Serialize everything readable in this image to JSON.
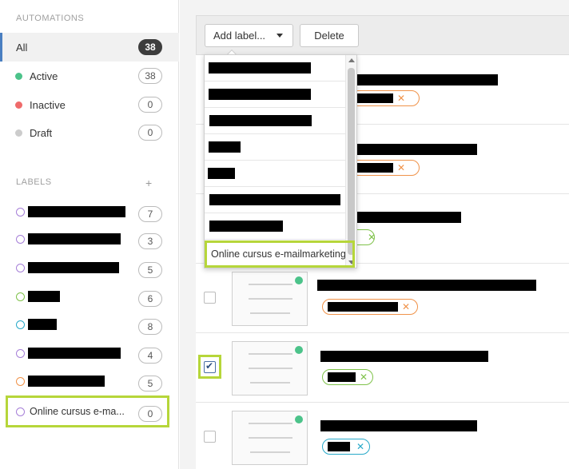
{
  "sidebar": {
    "automations_title": "AUTOMATIONS",
    "items": [
      {
        "label": "All",
        "count": "38"
      },
      {
        "label": "Active",
        "count": "38",
        "color": "#4cc38a"
      },
      {
        "label": "Inactive",
        "count": "0",
        "color": "#ef6b6b"
      },
      {
        "label": "Draft",
        "count": "0",
        "color": "#cccccc"
      }
    ],
    "labels_title": "LABELS",
    "add_icon": "+",
    "labels": [
      {
        "count": "7",
        "color": "#a67fd8"
      },
      {
        "count": "3",
        "color": "#a67fd8"
      },
      {
        "count": "5",
        "color": "#a67fd8"
      },
      {
        "count": "6",
        "color": "#7fc24a"
      },
      {
        "count": "8",
        "color": "#27a9c9"
      },
      {
        "count": "4",
        "color": "#a67fd8"
      },
      {
        "count": "5",
        "color": "#f0934a"
      },
      {
        "label": "Online cursus e-ma...",
        "count": "0",
        "color": "#a67fd8"
      }
    ]
  },
  "toolbar": {
    "add_label": "Add label...",
    "delete_label": "Delete"
  },
  "dropdown": {
    "highlighted_option": "Online cursus e-mailmarketing"
  },
  "rows": [
    {
      "tag_x": "✕",
      "tag_color": "#f0934a"
    },
    {
      "tag_x": "✕",
      "tag_color": "#f0934a"
    },
    {
      "tag_x": "✕",
      "tag_color": "#7fc24a"
    },
    {
      "tag_x": "✕",
      "tag_color": "#f0934a"
    },
    {
      "tag_x": "✕",
      "tag_color": "#7fc24a",
      "checked": true
    },
    {
      "tag_x": "✕",
      "tag_color": "#27a9c9"
    }
  ],
  "checkmark": "✔"
}
